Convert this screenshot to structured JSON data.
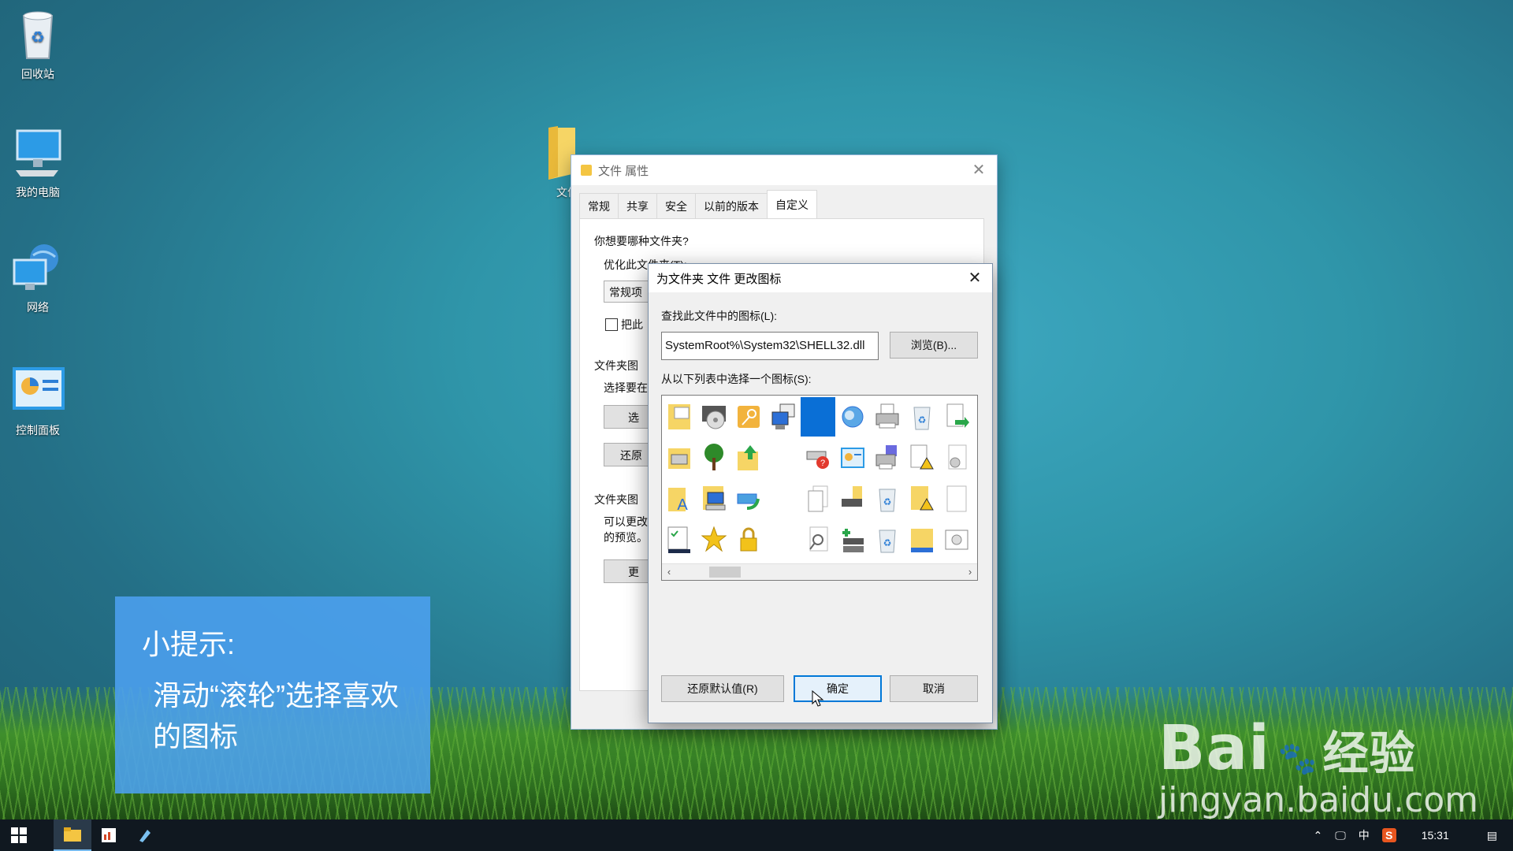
{
  "desktop": {
    "icons": [
      {
        "label": "回收站",
        "icon": "recycle-bin-icon"
      },
      {
        "label": "我的电脑",
        "icon": "computer-icon"
      },
      {
        "label": "网络",
        "icon": "network-icon"
      },
      {
        "label": "控制面板",
        "icon": "control-panel-icon"
      },
      {
        "label": "文件",
        "icon": "folder-icon"
      }
    ]
  },
  "properties_dialog": {
    "title": "文件 属性",
    "tabs": [
      "常规",
      "共享",
      "安全",
      "以前的版本",
      "自定义"
    ],
    "active_tab": "自定义",
    "q_label": "你想要哪种文件夹?",
    "optimize_label": "优化此文件夹(T):",
    "optimize_value": "常规项",
    "checkbox_label": "把此",
    "group2_label": "文件夹图",
    "group2_hint": "选择要在",
    "choose_btn": "选",
    "restore_btn": "还原",
    "group3_label": "文件夹图",
    "group3_line1": "可以更改",
    "group3_line2": "的预览。",
    "change_btn": "更"
  },
  "change_icon_dialog": {
    "title": "为文件夹 文件 更改图标",
    "find_label": "查找此文件中的图标(L):",
    "path_value": "SystemRoot%\\System32\\SHELL32.dll",
    "browse_button": "浏览(B)...",
    "choose_label": "从以下列表中选择一个图标(S):",
    "restore_default_button": "还原默认值(R)",
    "ok_button": "确定",
    "cancel_button": "取消",
    "icon_rows": [
      [
        "folder-grid-icon",
        "dvd-drive-icon",
        "key-icon",
        "computer-window-icon",
        "selected-blank-icon",
        "network-globe-icon",
        "printer-icon",
        "recycle-full-icon",
        "document-arrow-icon"
      ],
      [
        "folder-printer-icon",
        "tree-icon",
        "folder-up-icon",
        "blank-icon",
        "drive-help-icon",
        "control-panel-mini-icon",
        "printer-fax-icon",
        "document-warning-icon",
        "document-gear-icon"
      ],
      [
        "folder-font-icon",
        "folder-computer-icon",
        "refresh-drive-icon",
        "blank-icon",
        "documents-stack-icon",
        "drive-folder-icon",
        "recycle-empty-icon",
        "folder-warning-icon",
        "document-blank-icon"
      ],
      [
        "checklist-icon",
        "star-icon",
        "lock-icon",
        "blank-icon",
        "search-document-icon",
        "add-drive-icon",
        "recycle-icon",
        "folder-note-icon",
        "settings-window-icon"
      ]
    ]
  },
  "hint": {
    "title": "小提示:",
    "body": "滑动“滚轮”选择喜欢的图标"
  },
  "watermark": {
    "line1": "Bai",
    "line1_cn": "经验",
    "line2": "jingyan.baidu.com"
  },
  "taskbar": {
    "ime": "中",
    "time": "15:31"
  },
  "colors": {
    "selection": "#0a6fd6",
    "hint_bg": "#4ca0f0",
    "taskbar": "#101820"
  }
}
